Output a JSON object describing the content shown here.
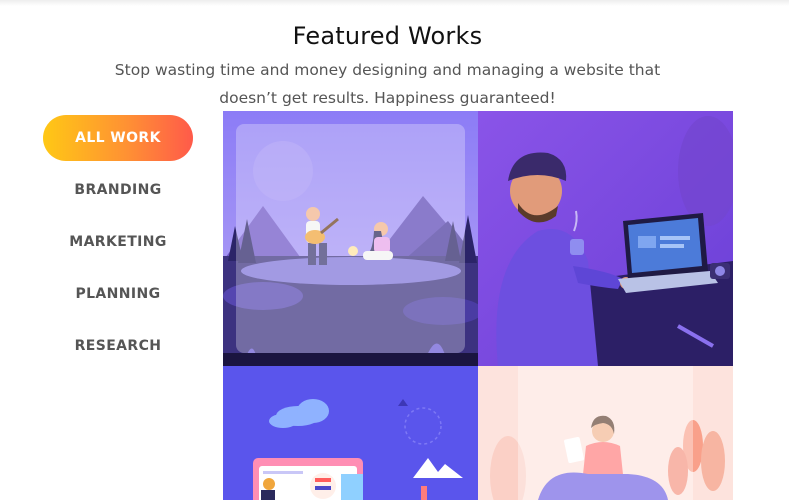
{
  "header": {
    "title": "Featured Works",
    "subtitle": "Stop wasting time and money designing and managing a website that doesn’t get results. Happiness guaranteed!"
  },
  "filters": [
    {
      "label": "ALL WORK",
      "active": true
    },
    {
      "label": "BRANDING",
      "active": false
    },
    {
      "label": "MARKETING",
      "active": false
    },
    {
      "label": "PLANNING",
      "active": false
    },
    {
      "label": "RESEARCH",
      "active": false
    }
  ],
  "portfolio": [
    {
      "illustration": "couple-guitar-campfire-lake"
    },
    {
      "illustration": "man-working-on-laptop"
    },
    {
      "illustration": "analytics-dashboard-clouds"
    },
    {
      "illustration": "woman-reading-plants"
    }
  ],
  "colors": {
    "accent_start": "#ffc815",
    "accent_end": "#ff5a4a",
    "tile_purple": "#7b5cf0",
    "tile_blue": "#5a55ec",
    "tile_peach": "#fde3dd"
  }
}
